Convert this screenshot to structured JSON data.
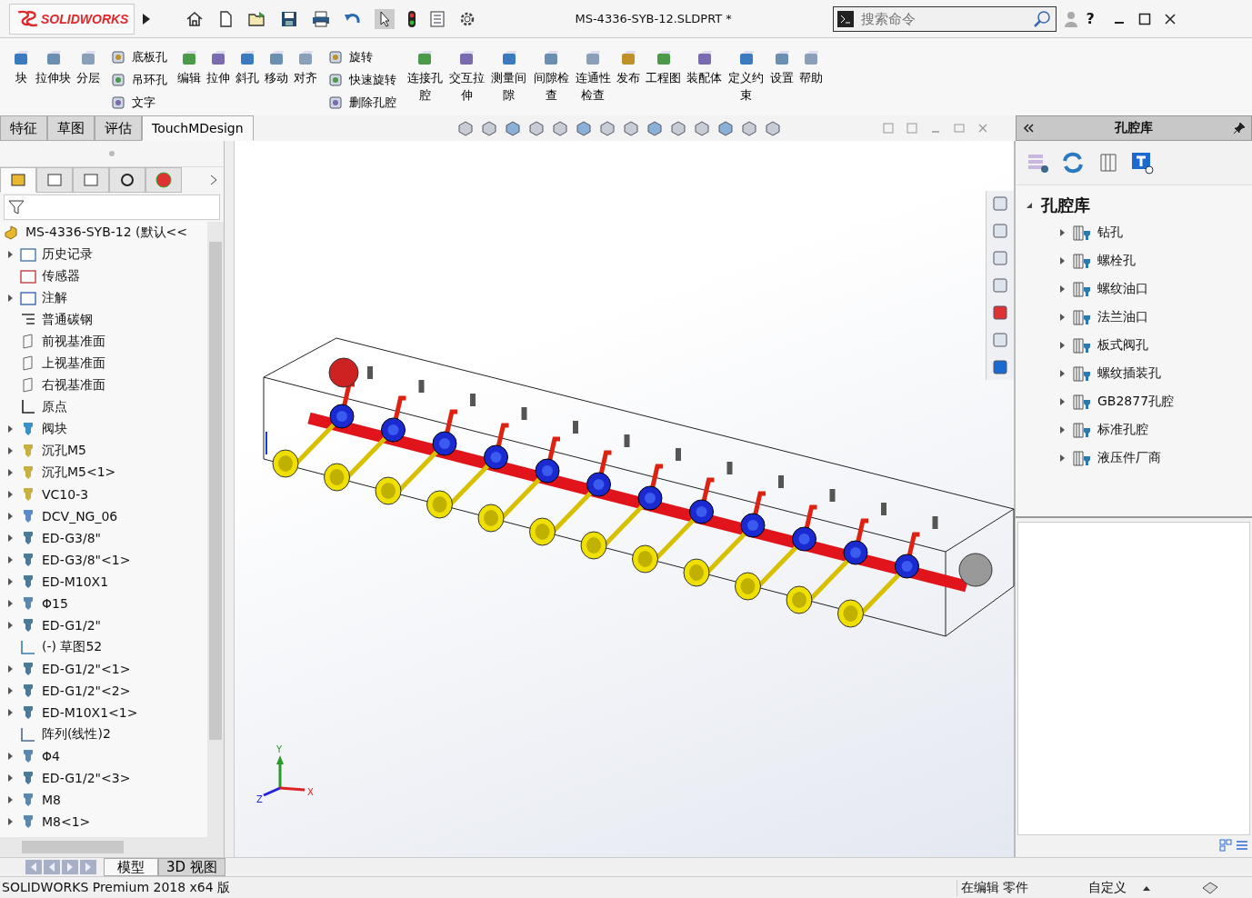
{
  "title_bar": {
    "logo": "SOLIDWORKS",
    "document_title": "MS-4336-SYB-12.SLDPRT *",
    "search": {
      "placeholder": "搜索命令"
    },
    "help": "?"
  },
  "ribbon": [
    {
      "kind": "large",
      "label": "块"
    },
    {
      "kind": "large",
      "label": "拉伸块"
    },
    {
      "kind": "large",
      "label": "分层"
    },
    {
      "kind": "stack",
      "items": [
        "底板孔",
        "吊环孔",
        "文字"
      ]
    },
    {
      "kind": "large",
      "label": "编辑"
    },
    {
      "kind": "large",
      "label": "拉伸"
    },
    {
      "kind": "large",
      "label": "斜孔"
    },
    {
      "kind": "large",
      "label": "移动"
    },
    {
      "kind": "large",
      "label": "对齐"
    },
    {
      "kind": "stack",
      "items": [
        "旋转",
        "快速旋转",
        "删除孔腔"
      ]
    },
    {
      "kind": "large",
      "label": "连接孔腔"
    },
    {
      "kind": "large",
      "label": "交互拉伸"
    },
    {
      "kind": "large",
      "label": "测量间隙"
    },
    {
      "kind": "large",
      "label": "间隙检查"
    },
    {
      "kind": "large",
      "label": "连通性检查"
    },
    {
      "kind": "large",
      "label": "发布"
    },
    {
      "kind": "large",
      "label": "工程图"
    },
    {
      "kind": "large",
      "label": "装配体"
    },
    {
      "kind": "large",
      "label": "定义约束"
    },
    {
      "kind": "large",
      "label": "设置"
    },
    {
      "kind": "large",
      "label": "帮助"
    }
  ],
  "command_tabs": [
    {
      "label": "特征",
      "selected": false
    },
    {
      "label": "草图",
      "selected": false
    },
    {
      "label": "评估",
      "selected": false
    },
    {
      "label": "TouchMDesign",
      "selected": true
    }
  ],
  "panel_tabs": [
    {
      "selected": true
    },
    {
      "selected": false
    },
    {
      "selected": false
    },
    {
      "selected": false
    },
    {
      "selected": false
    }
  ],
  "feature_tree": {
    "root": "MS-4336-SYB-12  (默认<<",
    "items": [
      {
        "label": "历史记录",
        "kind": "folder",
        "expandable": true
      },
      {
        "label": "传感器",
        "kind": "sensor",
        "expandable": false
      },
      {
        "label": "注解",
        "kind": "annotation",
        "expandable": true
      },
      {
        "label": "普通碳钢",
        "kind": "material",
        "expandable": false
      },
      {
        "label": "前视基准面",
        "kind": "plane",
        "expandable": false
      },
      {
        "label": "上视基准面",
        "kind": "plane",
        "expandable": false
      },
      {
        "label": "右视基准面",
        "kind": "plane",
        "expandable": false
      },
      {
        "label": "原点",
        "kind": "origin",
        "expandable": false
      },
      {
        "label": "阀块",
        "kind": "body",
        "expandable": true
      },
      {
        "label": "沉孔M5",
        "kind": "hole",
        "expandable": true
      },
      {
        "label": "沉孔M5<1>",
        "kind": "hole",
        "expandable": true
      },
      {
        "label": "VC10-3",
        "kind": "hole",
        "expandable": true
      },
      {
        "label": "DCV_NG_06",
        "kind": "valve",
        "expandable": true
      },
      {
        "label": "ED-G3/8\"",
        "kind": "port",
        "expandable": true
      },
      {
        "label": "ED-G3/8\"<1>",
        "kind": "port",
        "expandable": true
      },
      {
        "label": "ED-M10X1",
        "kind": "port",
        "expandable": true
      },
      {
        "label": "Φ15",
        "kind": "drill",
        "expandable": true
      },
      {
        "label": "ED-G1/2\"",
        "kind": "port",
        "expandable": true
      },
      {
        "label": "(-) 草图52",
        "kind": "sketch",
        "expandable": false
      },
      {
        "label": "ED-G1/2\"<1>",
        "kind": "port",
        "expandable": true
      },
      {
        "label": "ED-G1/2\"<2>",
        "kind": "port",
        "expandable": true
      },
      {
        "label": "ED-M10X1<1>",
        "kind": "port",
        "expandable": true
      },
      {
        "label": "阵列(线性)2",
        "kind": "pattern",
        "expandable": false
      },
      {
        "label": "Φ4",
        "kind": "drill",
        "expandable": true
      },
      {
        "label": "ED-G1/2\"<3>",
        "kind": "port",
        "expandable": true
      },
      {
        "label": "M8",
        "kind": "drill",
        "expandable": true
      },
      {
        "label": "M8<1>",
        "kind": "drill",
        "expandable": true
      }
    ]
  },
  "triad": {
    "y": "Y",
    "z": "Z",
    "x": "X"
  },
  "task_pane": {
    "title": "孔腔库",
    "tree": {
      "label": "孔腔库",
      "expanded": true,
      "children": [
        {
          "label": "钻孔"
        },
        {
          "label": "螺栓孔"
        },
        {
          "label": "螺纹油口"
        },
        {
          "label": "法兰油口"
        },
        {
          "label": "板式阀孔"
        },
        {
          "label": "螺纹插装孔"
        },
        {
          "label": "GB2877孔腔"
        },
        {
          "label": "标准孔腔"
        },
        {
          "label": "液压件厂商"
        }
      ]
    }
  },
  "bottom_tabs": [
    {
      "label": "模型",
      "selected": true
    },
    {
      "label": "3D 视图",
      "selected": false
    }
  ],
  "status_bar": {
    "product": "SOLIDWORKS Premium 2018 x64 版",
    "mode": "在编辑 零件",
    "units": "自定义"
  }
}
